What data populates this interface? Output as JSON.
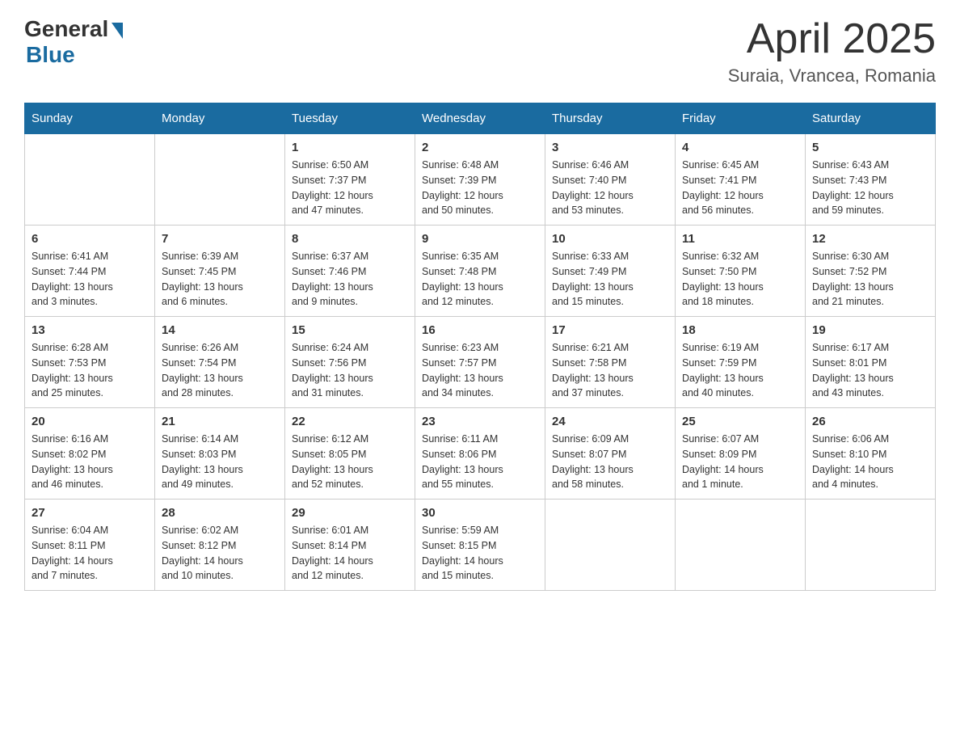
{
  "logo": {
    "general": "General",
    "blue": "Blue"
  },
  "header": {
    "month": "April 2025",
    "location": "Suraia, Vrancea, Romania"
  },
  "days_of_week": [
    "Sunday",
    "Monday",
    "Tuesday",
    "Wednesday",
    "Thursday",
    "Friday",
    "Saturday"
  ],
  "weeks": [
    [
      {
        "day": "",
        "info": ""
      },
      {
        "day": "",
        "info": ""
      },
      {
        "day": "1",
        "info": "Sunrise: 6:50 AM\nSunset: 7:37 PM\nDaylight: 12 hours\nand 47 minutes."
      },
      {
        "day": "2",
        "info": "Sunrise: 6:48 AM\nSunset: 7:39 PM\nDaylight: 12 hours\nand 50 minutes."
      },
      {
        "day": "3",
        "info": "Sunrise: 6:46 AM\nSunset: 7:40 PM\nDaylight: 12 hours\nand 53 minutes."
      },
      {
        "day": "4",
        "info": "Sunrise: 6:45 AM\nSunset: 7:41 PM\nDaylight: 12 hours\nand 56 minutes."
      },
      {
        "day": "5",
        "info": "Sunrise: 6:43 AM\nSunset: 7:43 PM\nDaylight: 12 hours\nand 59 minutes."
      }
    ],
    [
      {
        "day": "6",
        "info": "Sunrise: 6:41 AM\nSunset: 7:44 PM\nDaylight: 13 hours\nand 3 minutes."
      },
      {
        "day": "7",
        "info": "Sunrise: 6:39 AM\nSunset: 7:45 PM\nDaylight: 13 hours\nand 6 minutes."
      },
      {
        "day": "8",
        "info": "Sunrise: 6:37 AM\nSunset: 7:46 PM\nDaylight: 13 hours\nand 9 minutes."
      },
      {
        "day": "9",
        "info": "Sunrise: 6:35 AM\nSunset: 7:48 PM\nDaylight: 13 hours\nand 12 minutes."
      },
      {
        "day": "10",
        "info": "Sunrise: 6:33 AM\nSunset: 7:49 PM\nDaylight: 13 hours\nand 15 minutes."
      },
      {
        "day": "11",
        "info": "Sunrise: 6:32 AM\nSunset: 7:50 PM\nDaylight: 13 hours\nand 18 minutes."
      },
      {
        "day": "12",
        "info": "Sunrise: 6:30 AM\nSunset: 7:52 PM\nDaylight: 13 hours\nand 21 minutes."
      }
    ],
    [
      {
        "day": "13",
        "info": "Sunrise: 6:28 AM\nSunset: 7:53 PM\nDaylight: 13 hours\nand 25 minutes."
      },
      {
        "day": "14",
        "info": "Sunrise: 6:26 AM\nSunset: 7:54 PM\nDaylight: 13 hours\nand 28 minutes."
      },
      {
        "day": "15",
        "info": "Sunrise: 6:24 AM\nSunset: 7:56 PM\nDaylight: 13 hours\nand 31 minutes."
      },
      {
        "day": "16",
        "info": "Sunrise: 6:23 AM\nSunset: 7:57 PM\nDaylight: 13 hours\nand 34 minutes."
      },
      {
        "day": "17",
        "info": "Sunrise: 6:21 AM\nSunset: 7:58 PM\nDaylight: 13 hours\nand 37 minutes."
      },
      {
        "day": "18",
        "info": "Sunrise: 6:19 AM\nSunset: 7:59 PM\nDaylight: 13 hours\nand 40 minutes."
      },
      {
        "day": "19",
        "info": "Sunrise: 6:17 AM\nSunset: 8:01 PM\nDaylight: 13 hours\nand 43 minutes."
      }
    ],
    [
      {
        "day": "20",
        "info": "Sunrise: 6:16 AM\nSunset: 8:02 PM\nDaylight: 13 hours\nand 46 minutes."
      },
      {
        "day": "21",
        "info": "Sunrise: 6:14 AM\nSunset: 8:03 PM\nDaylight: 13 hours\nand 49 minutes."
      },
      {
        "day": "22",
        "info": "Sunrise: 6:12 AM\nSunset: 8:05 PM\nDaylight: 13 hours\nand 52 minutes."
      },
      {
        "day": "23",
        "info": "Sunrise: 6:11 AM\nSunset: 8:06 PM\nDaylight: 13 hours\nand 55 minutes."
      },
      {
        "day": "24",
        "info": "Sunrise: 6:09 AM\nSunset: 8:07 PM\nDaylight: 13 hours\nand 58 minutes."
      },
      {
        "day": "25",
        "info": "Sunrise: 6:07 AM\nSunset: 8:09 PM\nDaylight: 14 hours\nand 1 minute."
      },
      {
        "day": "26",
        "info": "Sunrise: 6:06 AM\nSunset: 8:10 PM\nDaylight: 14 hours\nand 4 minutes."
      }
    ],
    [
      {
        "day": "27",
        "info": "Sunrise: 6:04 AM\nSunset: 8:11 PM\nDaylight: 14 hours\nand 7 minutes."
      },
      {
        "day": "28",
        "info": "Sunrise: 6:02 AM\nSunset: 8:12 PM\nDaylight: 14 hours\nand 10 minutes."
      },
      {
        "day": "29",
        "info": "Sunrise: 6:01 AM\nSunset: 8:14 PM\nDaylight: 14 hours\nand 12 minutes."
      },
      {
        "day": "30",
        "info": "Sunrise: 5:59 AM\nSunset: 8:15 PM\nDaylight: 14 hours\nand 15 minutes."
      },
      {
        "day": "",
        "info": ""
      },
      {
        "day": "",
        "info": ""
      },
      {
        "day": "",
        "info": ""
      }
    ]
  ]
}
